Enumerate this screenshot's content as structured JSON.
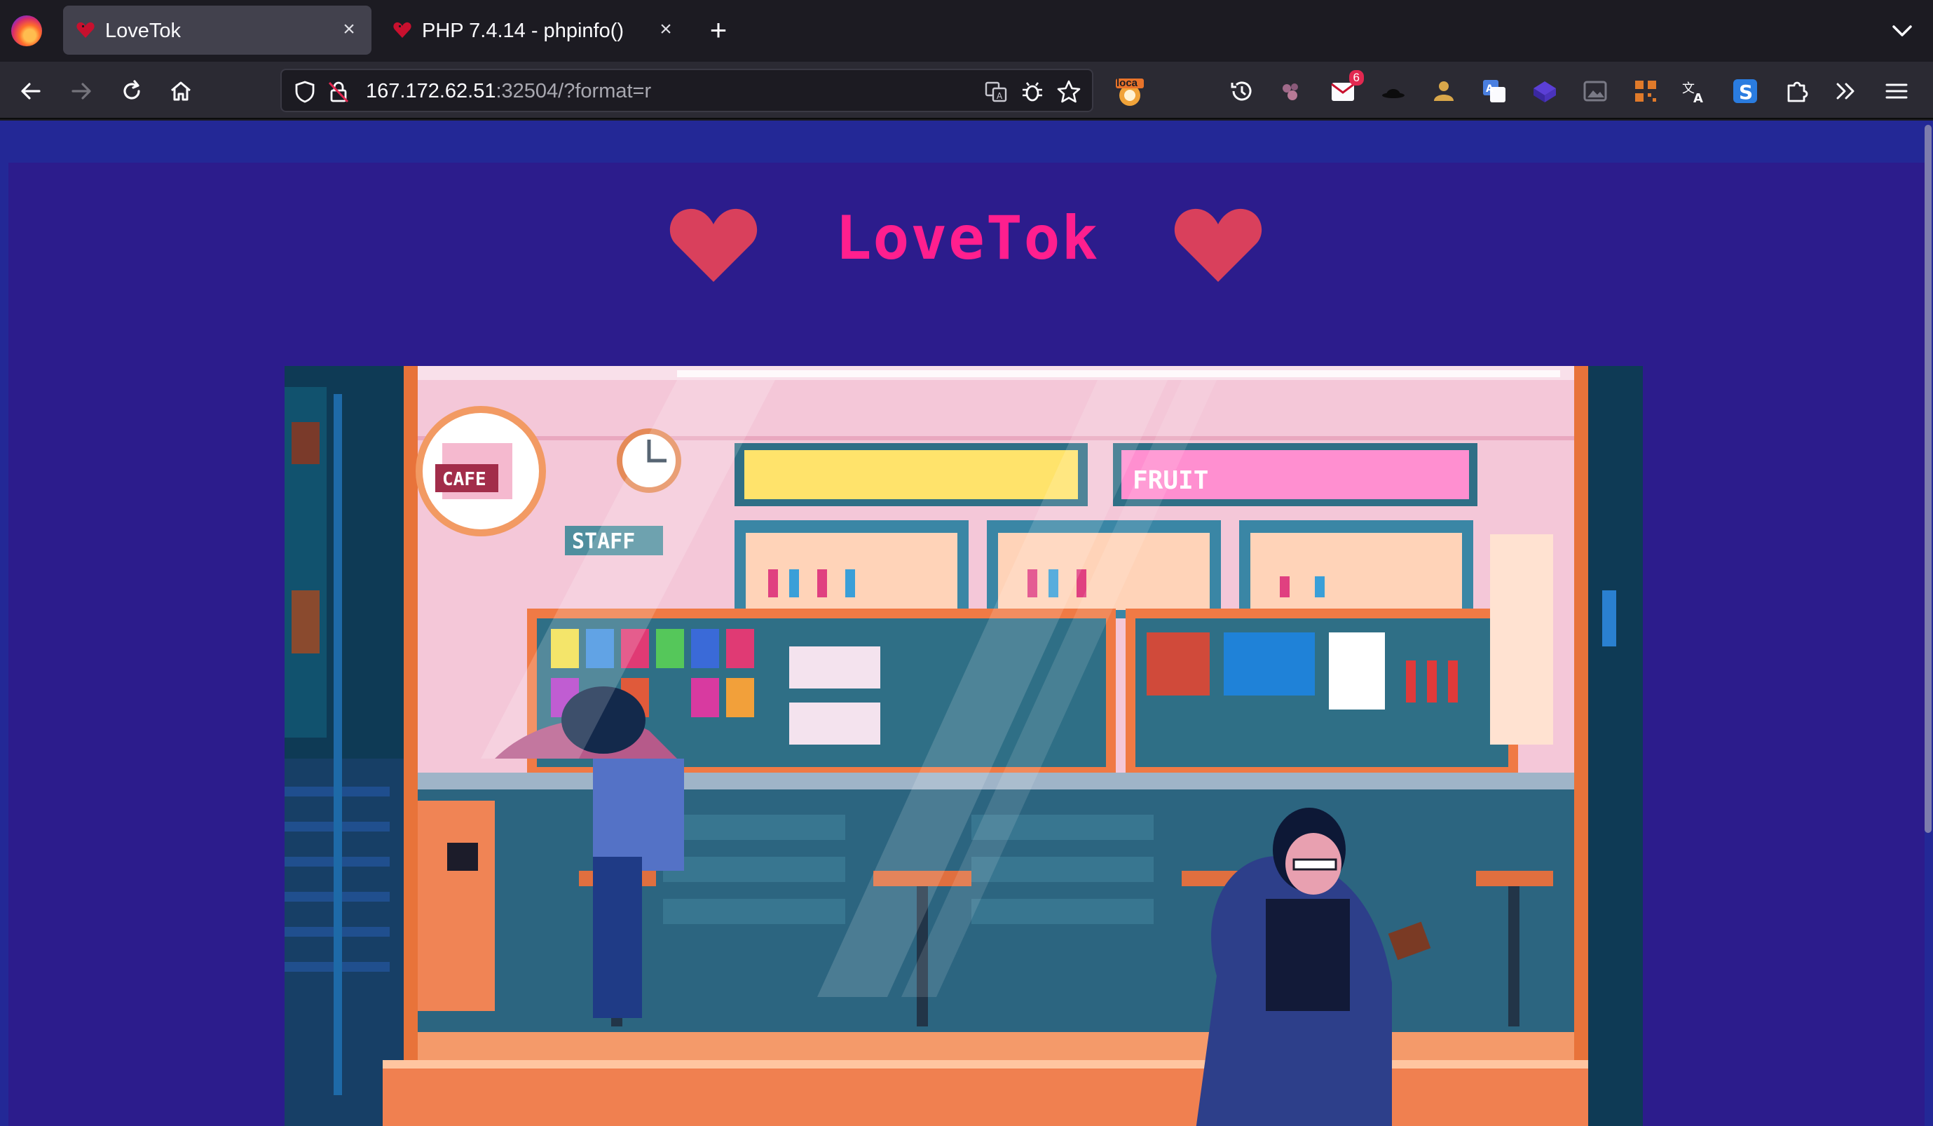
{
  "browser": {
    "tabs": [
      {
        "title": "LoveTok",
        "active": true
      },
      {
        "title": "PHP 7.4.14 - phpinfo()",
        "active": false
      }
    ],
    "new_tab_symbol": "+",
    "close_symbol": "×",
    "url": {
      "host": "167.172.62.51",
      "rest": ":32504/?format=r"
    },
    "toolbar_badge": "6",
    "extension_label": "loca",
    "colors": {
      "tab_bg": "#1c1b22",
      "active_tab": "#42414d",
      "nav_bg": "#2b2a33"
    }
  },
  "page": {
    "title": "LoveTok",
    "title_color": "#ff1f8e",
    "heart_color": "#d9405c",
    "background": "#232896",
    "panel": "#2c1c8c",
    "hero_image": "pixel-art late-night convenience store scene"
  }
}
